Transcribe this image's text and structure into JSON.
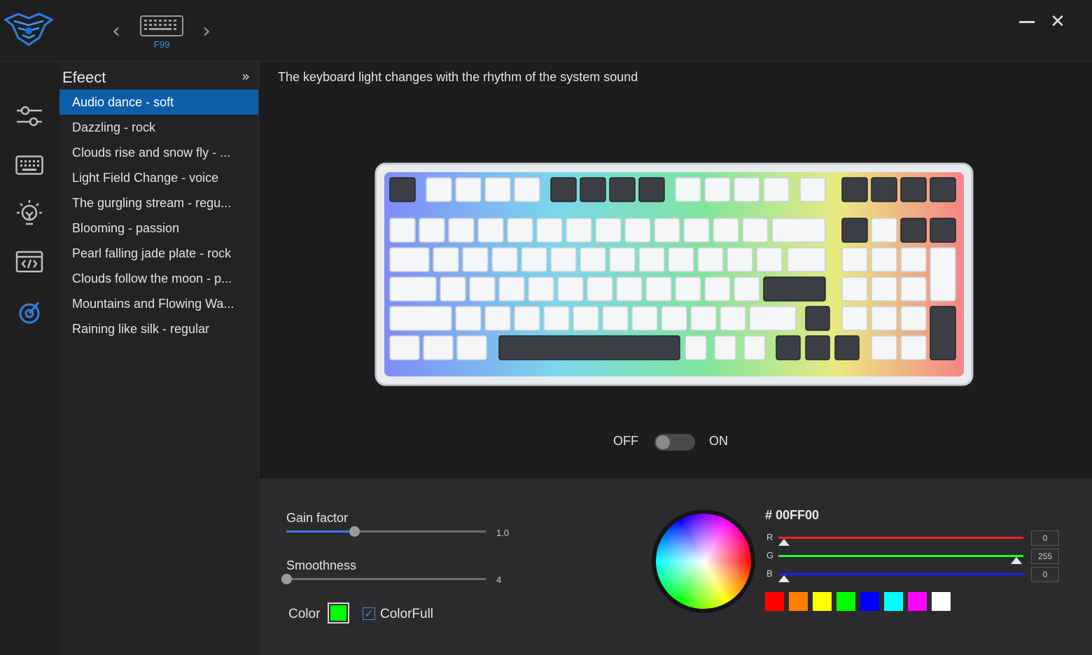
{
  "device": {
    "name": "F99"
  },
  "icons": {
    "logo": "aula-spider-logo-icon",
    "prev": "chevron-left-icon",
    "next": "chevron-right-icon",
    "minimize": "minimize-icon",
    "close": "close-icon",
    "rail": [
      "sliders-icon",
      "keyboard-icon",
      "lightbulb-icon",
      "macro-code-icon",
      "sound-icon"
    ]
  },
  "effect_panel": {
    "title": "Efeect",
    "items": [
      "Audio dance - soft",
      "Dazzling - rock",
      "Clouds rise and snow fly - ...",
      "Light Field Change - voice",
      "The gurgling stream - regu...",
      "Blooming - passion",
      "Pearl falling jade plate - rock",
      "Clouds follow the moon - p...",
      "Mountains and Flowing Wa...",
      "Raining like silk - regular"
    ],
    "active_index": 0
  },
  "main": {
    "description": "The keyboard light changes with the rhythm of the system sound",
    "toggle": {
      "off_label": "OFF",
      "on_label": "ON",
      "state": "off"
    }
  },
  "settings": {
    "gain": {
      "label": "Gain factor",
      "value": "1.0",
      "fraction": 0.34
    },
    "smoothness": {
      "label": "Smoothness",
      "value": "4",
      "fraction": 0.0
    },
    "color_label": "Color",
    "colorfull_label": "ColorFull",
    "colorfull_checked": true,
    "current_color": "#00ff00"
  },
  "color_picker": {
    "hex": "# 00FF00",
    "r": {
      "label": "R",
      "value": "0"
    },
    "g": {
      "label": "G",
      "value": "255"
    },
    "b": {
      "label": "B",
      "value": "0"
    },
    "presets": [
      "#ff0000",
      "#ff7f00",
      "#ffff00",
      "#00ff00",
      "#0000ff",
      "#00ffff",
      "#ff00ff",
      "#ffffff"
    ]
  }
}
